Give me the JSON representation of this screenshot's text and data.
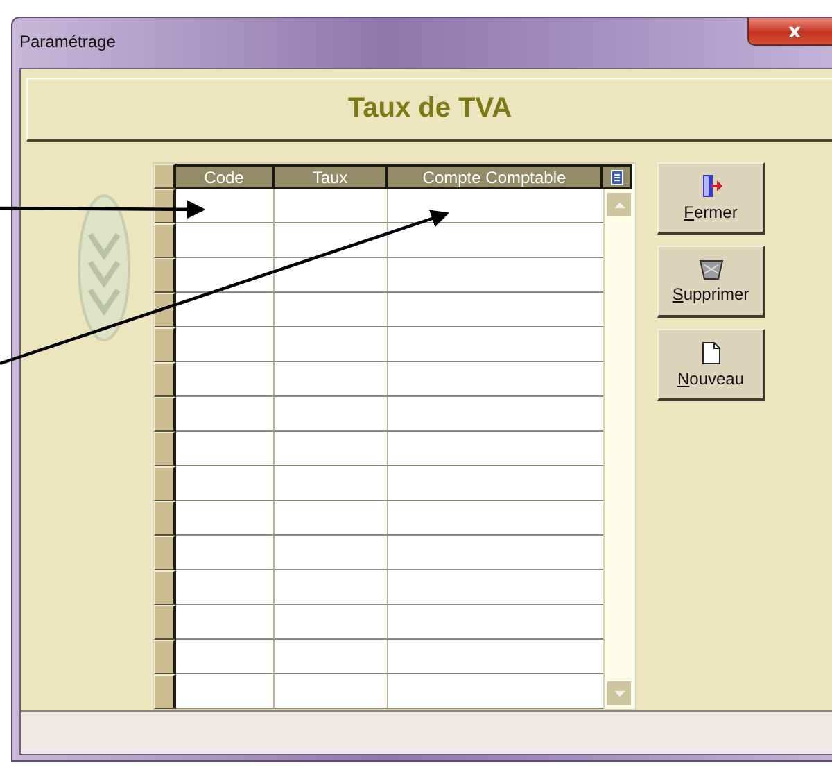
{
  "window": {
    "title": "Paramétrage",
    "close": "x"
  },
  "header": {
    "title": "Taux de TVA"
  },
  "table": {
    "columns": [
      "Code",
      "Taux",
      "Compte Comptable"
    ]
  },
  "buttons": [
    {
      "label": "Fermer",
      "kind": "close"
    },
    {
      "label": "Supprimer",
      "kind": "delete"
    },
    {
      "label": "Nouveau",
      "kind": "new"
    }
  ]
}
